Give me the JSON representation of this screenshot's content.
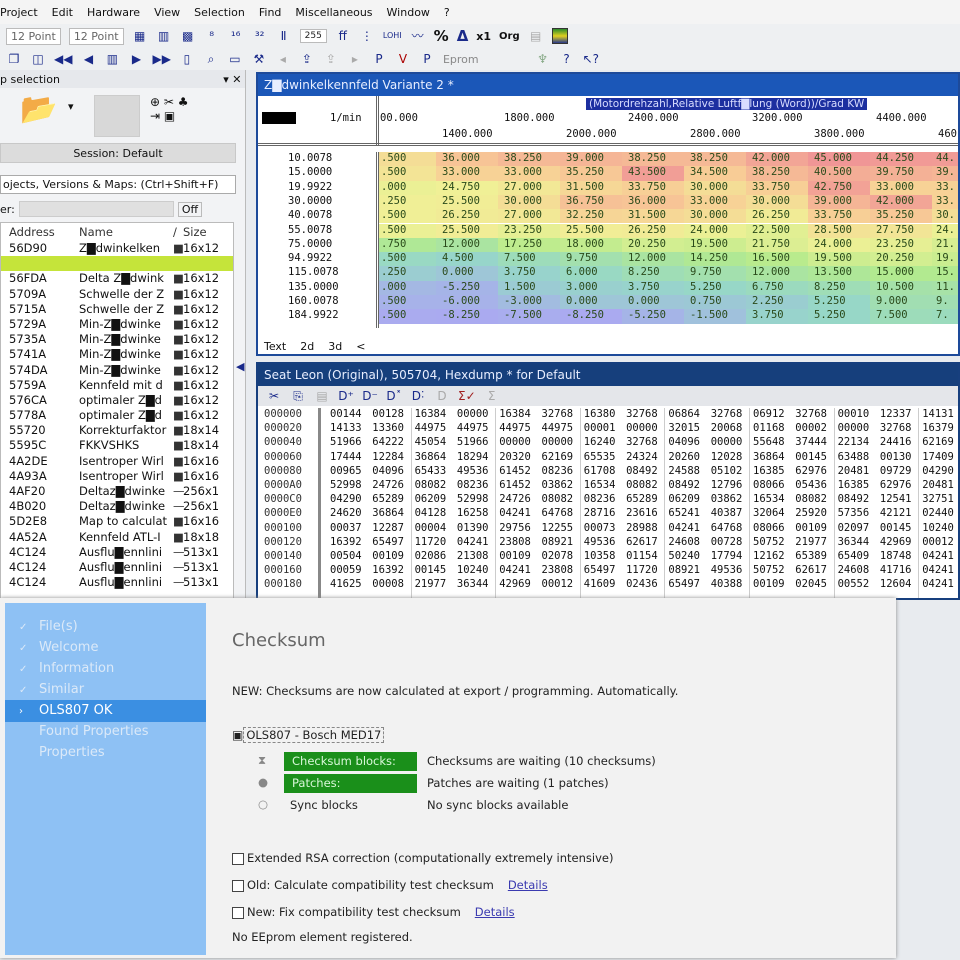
{
  "menu": [
    "Project",
    "Edit",
    "Hardware",
    "View",
    "Selection",
    "Find",
    "Miscellaneous",
    "Window",
    "?"
  ],
  "toolbar": {
    "font_size_1": "12 Point",
    "font_size_2": "12 Point",
    "value_255": "255",
    "percent": "%",
    "delta": "Δ",
    "x1": "x1",
    "org": "Org",
    "eprom": "Eprom"
  },
  "left_panel": {
    "title": "p selection",
    "session": "Session: Default",
    "search": "ojects, Versions & Maps:  (Ctrl+Shift+F)",
    "filter_label": "er:",
    "filter_off": "Off",
    "columns": [
      "Address",
      "Name",
      "/",
      "Size"
    ],
    "rows": [
      [
        "56D90",
        "Z▇dwinkelken",
        "■",
        "16x12"
      ],
      [
        "",
        "",
        "",
        ""
      ],
      [
        "56FDA",
        "Delta Z▇dwink",
        "■",
        "16x12"
      ],
      [
        "5709A",
        "Schwelle der Z",
        "■",
        "16x12"
      ],
      [
        "5715A",
        "Schwelle der Z",
        "■",
        "16x12"
      ],
      [
        "5729A",
        "Min-Z▇dwinke",
        "■",
        "16x12"
      ],
      [
        "5735A",
        "Min-Z▇dwinke",
        "■",
        "16x12"
      ],
      [
        "5741A",
        "Min-Z▇dwinke",
        "■",
        "16x12"
      ],
      [
        "574DA",
        "Min-Z▇dwinke",
        "■",
        "16x12"
      ],
      [
        "5759A",
        "Kennfeld mit d",
        "■",
        "16x12"
      ],
      [
        "576CA",
        "optimaler Z▇d",
        "■",
        "16x12"
      ],
      [
        "5778A",
        "optimaler Z▇d",
        "■",
        "16x12"
      ],
      [
        "55720",
        "Korrekturfaktor",
        "■",
        "18x14"
      ],
      [
        "5595C",
        "FKKVSHKS",
        "■",
        "18x14"
      ],
      [
        "4A2DE",
        "Isentroper Wirl",
        "■",
        "16x16"
      ],
      [
        "4A93A",
        "Isentroper Wirl",
        "■",
        "16x16"
      ],
      [
        "4AF20",
        "Deltaz▇dwinke",
        "—",
        "256x1"
      ],
      [
        "4B020",
        "Deltaz▇dwinke",
        "—",
        "256x1"
      ],
      [
        "5D2E8",
        "Map to calculat",
        "■",
        "16x16"
      ],
      [
        "4A52A",
        "Kennfeld ATL-I",
        "■",
        "18x18"
      ],
      [
        "4C124",
        "Ausflu▇ennlini",
        "—",
        "513x1"
      ],
      [
        "4C124",
        "Ausflu▇ennlini",
        "—",
        "513x1"
      ],
      [
        "4C124",
        "Ausflu▇ennlini",
        "—",
        "513x1"
      ]
    ]
  },
  "map_window": {
    "title": "Z▇dwinkelkennfeld Variante 2 *",
    "axis_desc": "(Motordrehzahl,Relative Luftf▇lung (Word))/Grad KW",
    "x_unit": "1/min",
    "x_labels_top": [
      "00.000",
      "1800.000",
      "2400.000",
      "3200.000",
      "4400.000"
    ],
    "x_labels_bottom": [
      "1400.000",
      "2000.000",
      "2800.000",
      "3800.000",
      "460"
    ],
    "tabs": [
      "Text",
      "2d",
      "3d",
      "<"
    ],
    "row_labels": [
      "10.0078",
      "15.0000",
      "19.9922",
      "30.0000",
      "40.0078",
      "55.0078",
      "75.0000",
      "94.9922",
      "115.0078",
      "135.0000",
      "160.0078",
      "184.9922"
    ],
    "cells": [
      [
        ".500",
        "36.000",
        "38.250",
        "39.000",
        "38.250",
        "38.250",
        "42.000",
        "45.000",
        "44.250",
        "44."
      ],
      [
        ".500",
        "33.000",
        "33.000",
        "35.250",
        "43.500",
        "34.500",
        "38.250",
        "40.500",
        "39.750",
        "39."
      ],
      [
        ".000",
        "24.750",
        "27.000",
        "31.500",
        "33.750",
        "30.000",
        "33.750",
        "42.750",
        "33.000",
        "33."
      ],
      [
        ".250",
        "25.500",
        "30.000",
        "36.750",
        "36.000",
        "33.000",
        "30.000",
        "39.000",
        "42.000",
        "33."
      ],
      [
        ".500",
        "26.250",
        "27.000",
        "32.250",
        "31.500",
        "30.000",
        "26.250",
        "33.750",
        "35.250",
        "30."
      ],
      [
        ".500",
        "25.500",
        "23.250",
        "25.500",
        "26.250",
        "24.000",
        "22.500",
        "28.500",
        "27.750",
        "24."
      ],
      [
        ".750",
        "12.000",
        "17.250",
        "18.000",
        "20.250",
        "19.500",
        "21.750",
        "24.000",
        "23.250",
        "21."
      ],
      [
        ".500",
        "4.500",
        "7.500",
        "9.750",
        "12.000",
        "14.250",
        "16.500",
        "19.500",
        "20.250",
        "19."
      ],
      [
        ".250",
        "0.000",
        "3.750",
        "6.000",
        "8.250",
        "9.750",
        "12.000",
        "13.500",
        "15.000",
        "15."
      ],
      [
        ".000",
        "-5.250",
        "1.500",
        "3.000",
        "3.750",
        "5.250",
        "6.750",
        "8.250",
        "10.500",
        "11."
      ],
      [
        ".500",
        "-6.000",
        "-3.000",
        "0.000",
        "0.000",
        "0.750",
        "2.250",
        "5.250",
        "9.000",
        "9."
      ],
      [
        ".500",
        "-8.250",
        "-7.500",
        "-8.250",
        "-5.250",
        "-1.500",
        "3.750",
        "5.250",
        "7.500",
        "7."
      ]
    ]
  },
  "hex_window": {
    "title": "Seat Leon (Original), 505704, Hexdump * for Default",
    "addresses": [
      "000000",
      "000020",
      "000040",
      "000060",
      "000080",
      "0000A0",
      "0000C0",
      "0000E0",
      "000100",
      "000120",
      "000140",
      "000160",
      "000180"
    ],
    "rows": [
      [
        "00144",
        "00128",
        "16384",
        "00000",
        "16384",
        "32768",
        "16380",
        "32768",
        "06864",
        "32768",
        "06912",
        "32768",
        "00010",
        "12337",
        "14131"
      ],
      [
        "14133",
        "13360",
        "44975",
        "44975",
        "44975",
        "44975",
        "00001",
        "00000",
        "32015",
        "20068",
        "01168",
        "00002",
        "00000",
        "32768",
        "16379"
      ],
      [
        "51966",
        "64222",
        "45054",
        "51966",
        "00000",
        "00000",
        "16240",
        "32768",
        "04096",
        "00000",
        "55648",
        "37444",
        "22134",
        "24416",
        "62169"
      ],
      [
        "17444",
        "12284",
        "36864",
        "18294",
        "20320",
        "62169",
        "65535",
        "24324",
        "20260",
        "12028",
        "36864",
        "00145",
        "63488",
        "00130",
        "17409"
      ],
      [
        "00965",
        "04096",
        "65433",
        "49536",
        "61452",
        "08236",
        "61708",
        "08492",
        "24588",
        "05102",
        "16385",
        "62976",
        "20481",
        "09729",
        "04290"
      ],
      [
        "52998",
        "24726",
        "08082",
        "08236",
        "61452",
        "03862",
        "16534",
        "08082",
        "08492",
        "12796",
        "08066",
        "05436",
        "16385",
        "62976",
        "20481"
      ],
      [
        "04290",
        "65289",
        "06209",
        "52998",
        "24726",
        "08082",
        "08236",
        "65289",
        "06209",
        "03862",
        "16534",
        "08082",
        "08492",
        "12541",
        "32751"
      ],
      [
        "24620",
        "36864",
        "04128",
        "16258",
        "04241",
        "64768",
        "28716",
        "23616",
        "65241",
        "40387",
        "32064",
        "25920",
        "57356",
        "42121",
        "02440"
      ],
      [
        "00037",
        "12287",
        "00004",
        "01390",
        "29756",
        "12255",
        "00073",
        "28988",
        "04241",
        "64768",
        "08066",
        "00109",
        "02097",
        "00145",
        "10240"
      ],
      [
        "16392",
        "65497",
        "11720",
        "04241",
        "23808",
        "08921",
        "49536",
        "62617",
        "24608",
        "00728",
        "50752",
        "21977",
        "36344",
        "42969",
        "00012"
      ],
      [
        "00504",
        "00109",
        "02086",
        "21308",
        "00109",
        "02078",
        "10358",
        "01154",
        "50240",
        "17794",
        "12162",
        "65389",
        "65409",
        "18748",
        "04241"
      ],
      [
        "00059",
        "16392",
        "00145",
        "10240",
        "04241",
        "23808",
        "65497",
        "11720",
        "08921",
        "49536",
        "50752",
        "62617",
        "24608",
        "41716",
        "04241"
      ],
      [
        "41625",
        "00008",
        "21977",
        "36344",
        "42969",
        "00012",
        "41609",
        "02436",
        "65497",
        "40388",
        "00109",
        "02045",
        "00552",
        "12604",
        "04241"
      ]
    ]
  },
  "checksum": {
    "sidebar": [
      "File(s)",
      "Welcome",
      "Information",
      "Similar",
      "OLS807 OK",
      "Found Properties",
      "Properties"
    ],
    "title": "Checksum",
    "notice": "NEW:  Checksums are now calculated at export / programming. Automatically.",
    "ecu": "OLS807 - Bosch MED17",
    "blocks": [
      {
        "label": "Checksum blocks:",
        "status": "Checksums are waiting (10 checksums)",
        "highlight": true
      },
      {
        "label": "Patches:",
        "status": "Patches are waiting (1 patches)",
        "highlight": true
      },
      {
        "label": "Sync blocks",
        "status": "No sync blocks available",
        "highlight": false
      }
    ],
    "options": [
      {
        "label": "Extended RSA correction (computationally extremely intensive)",
        "link": ""
      },
      {
        "label": "Old: Calculate compatibility test checksum",
        "link": "Details"
      },
      {
        "label": "New: Fix compatibility test checksum",
        "link": "Details"
      }
    ],
    "footer": "No EEprom element registered."
  },
  "colors": {
    "title_blue": "#1b57b8",
    "selection": "#c5e43a",
    "green": "#1a8f1a",
    "sidebar": "#8ec1f4"
  }
}
